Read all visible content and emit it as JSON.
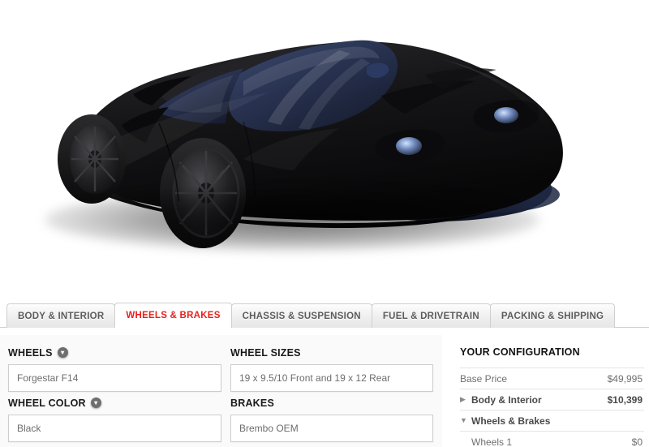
{
  "preview": {
    "vehicle_alt": "Black mid-engine supercar, three-quarter front view"
  },
  "tabs": [
    {
      "label": "BODY & INTERIOR",
      "active": false
    },
    {
      "label": "WHEELS & BRAKES",
      "active": true
    },
    {
      "label": "CHASSIS & SUSPENSION",
      "active": false
    },
    {
      "label": "FUEL & DRIVETRAIN",
      "active": false
    },
    {
      "label": "PACKING & SHIPPING",
      "active": false
    }
  ],
  "options": [
    {
      "label": "WHEELS",
      "value": "Forgestar F14",
      "has_info": true
    },
    {
      "label": "WHEEL SIZES",
      "value": "19 x 9.5/10 Front and 19 x 12 Rear",
      "has_info": false
    },
    {
      "label": "WHEEL COLOR",
      "value": "Black",
      "has_info": true
    },
    {
      "label": "BRAKES",
      "value": "Brembo OEM",
      "has_info": false
    }
  ],
  "info_badge_glyph": "▾",
  "configuration": {
    "title": "YOUR CONFIGURATION",
    "rows": [
      {
        "name": "Base Price",
        "price": "$49,995",
        "type": "item",
        "caret": ""
      },
      {
        "name": "Body & Interior",
        "price": "$10,399",
        "type": "group",
        "caret": "▶"
      },
      {
        "name": "Wheels & Brakes",
        "price": "",
        "type": "group",
        "caret": "▼"
      },
      {
        "name": "Wheels 1",
        "price": "$0",
        "type": "child",
        "caret": ""
      }
    ]
  },
  "colors": {
    "accent_red": "#e8201c",
    "pane_bg": "#fafafa",
    "border": "#cdcdcd"
  }
}
